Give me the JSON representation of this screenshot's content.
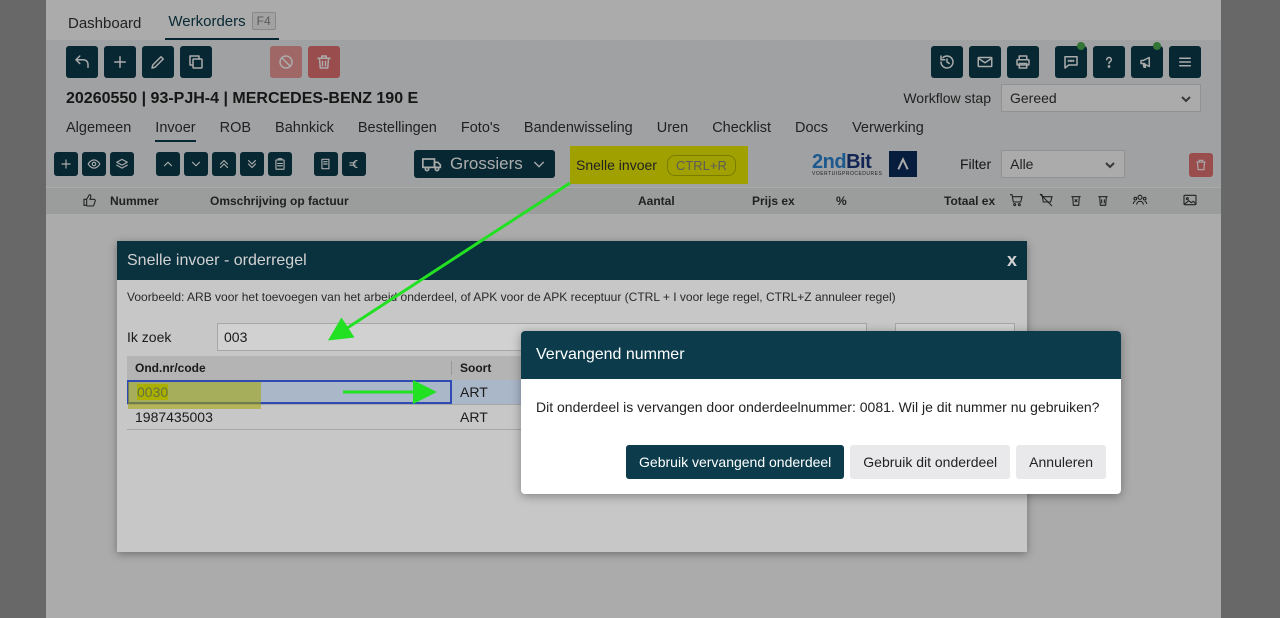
{
  "topnav": {
    "tabs": [
      {
        "label": "Dashboard"
      },
      {
        "label": "Werkorders",
        "shortcut": "F4"
      }
    ]
  },
  "workorder": {
    "title": "20260550 | 93-PJH-4 | MERCEDES-BENZ 190 E",
    "workflow_label": "Workflow stap",
    "workflow_value": "Gereed"
  },
  "subtabs": [
    "Algemeen",
    "Invoer",
    "ROB",
    "Bahnkick",
    "Bestellingen",
    "Foto's",
    "Bandenwisseling",
    "Uren",
    "Checklist",
    "Docs",
    "Verwerking"
  ],
  "toolbar2": {
    "grossiers_label": "Grossiers",
    "snelle_label": "Snelle invoer",
    "snelle_shortcut": "CTRL+R",
    "logo_2nd": "2nd",
    "logo_bit": "Bit",
    "logo_sub": "VOERTUIGPROCEDURES",
    "filter_label": "Filter",
    "filter_value": "Alle"
  },
  "columns": {
    "nummer": "Nummer",
    "omschrijving": "Omschrijving op factuur",
    "aantal": "Aantal",
    "prijs": "Prijs ex",
    "pct": "%",
    "totaal": "Totaal ex"
  },
  "dialog_quick": {
    "title": "Snelle invoer - orderregel",
    "close": "x",
    "example": "Voorbeeld: ARB voor het toevoegen van het arbeid onderdeel, of APK voor de APK receptuur (CTRL + I voor lege regel, CTRL+Z annuleer regel)",
    "search_label": "Ik zoek",
    "search_value": "003",
    "col_code": "Ond.nr/code",
    "col_soort": "Soort",
    "rows": [
      {
        "code": "0030",
        "soort": "ART"
      },
      {
        "code": "1987435003",
        "soort": "ART"
      }
    ]
  },
  "dialog_replace": {
    "title": "Vervangend nummer",
    "message": "Dit onderdeel is vervangen door onderdeelnummer: 0081. Wil je dit nummer nu gebruiken?",
    "btn_use_replacement": "Gebruik vervangend onderdeel",
    "btn_use_this": "Gebruik dit onderdeel",
    "btn_cancel": "Annuleren"
  },
  "colors": {
    "primary": "#0c3c4c",
    "danger": "#e57373",
    "highlight": "#f0f000",
    "arrow": "#22e022"
  }
}
